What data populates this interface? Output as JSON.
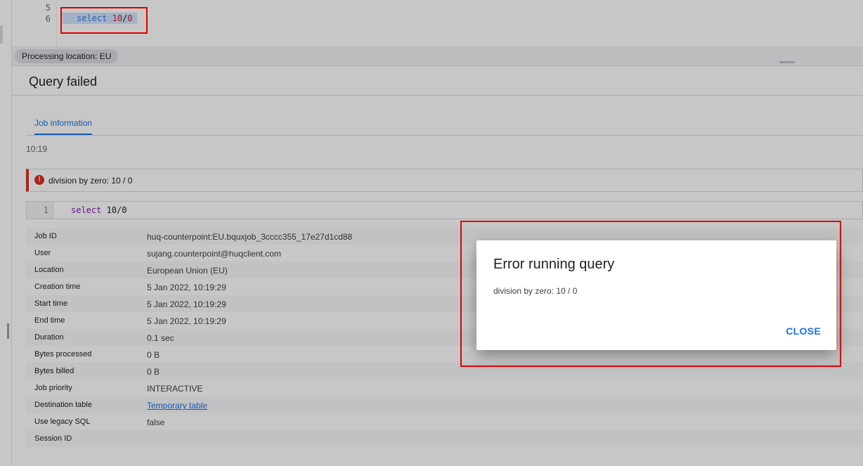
{
  "editor": {
    "lines": [
      {
        "num": "5",
        "code": ""
      },
      {
        "num": "6",
        "keyword": "select",
        "value_a": "10",
        "op": "/",
        "value_b": "0"
      }
    ]
  },
  "processing_location": "Processing location: EU",
  "results": {
    "title": "Query failed",
    "tab": "Job information",
    "timestamp": "10:19",
    "error_message": "division by zero: 10 / 0",
    "query": {
      "line": "1",
      "keyword": "select",
      "rest": "10/0"
    }
  },
  "job_info": [
    {
      "label": "Job ID",
      "value": "huq-counterpoint:EU.bquxjob_3cccc355_17e27d1cd88"
    },
    {
      "label": "User",
      "value": "sujang.counterpoint@huqclient.com"
    },
    {
      "label": "Location",
      "value": "European Union (EU)"
    },
    {
      "label": "Creation time",
      "value": "5 Jan 2022, 10:19:29"
    },
    {
      "label": "Start time",
      "value": "5 Jan 2022, 10:19:29"
    },
    {
      "label": "End time",
      "value": "5 Jan 2022, 10:19:29"
    },
    {
      "label": "Duration",
      "value": "0.1 sec"
    },
    {
      "label": "Bytes processed",
      "value": "0 B"
    },
    {
      "label": "Bytes billed",
      "value": "0 B"
    },
    {
      "label": "Job priority",
      "value": "INTERACTIVE"
    },
    {
      "label": "Destination table",
      "value": "Temporary table"
    },
    {
      "label": "Use legacy SQL",
      "value": "false"
    },
    {
      "label": "Session ID",
      "value": ""
    }
  ],
  "dialog": {
    "title": "Error running query",
    "message": "division by zero: 10 / 0",
    "close_label": "CLOSE"
  },
  "colors": {
    "accent": "#1a73e8",
    "error": "#d93025",
    "annotation": "#e00000"
  }
}
